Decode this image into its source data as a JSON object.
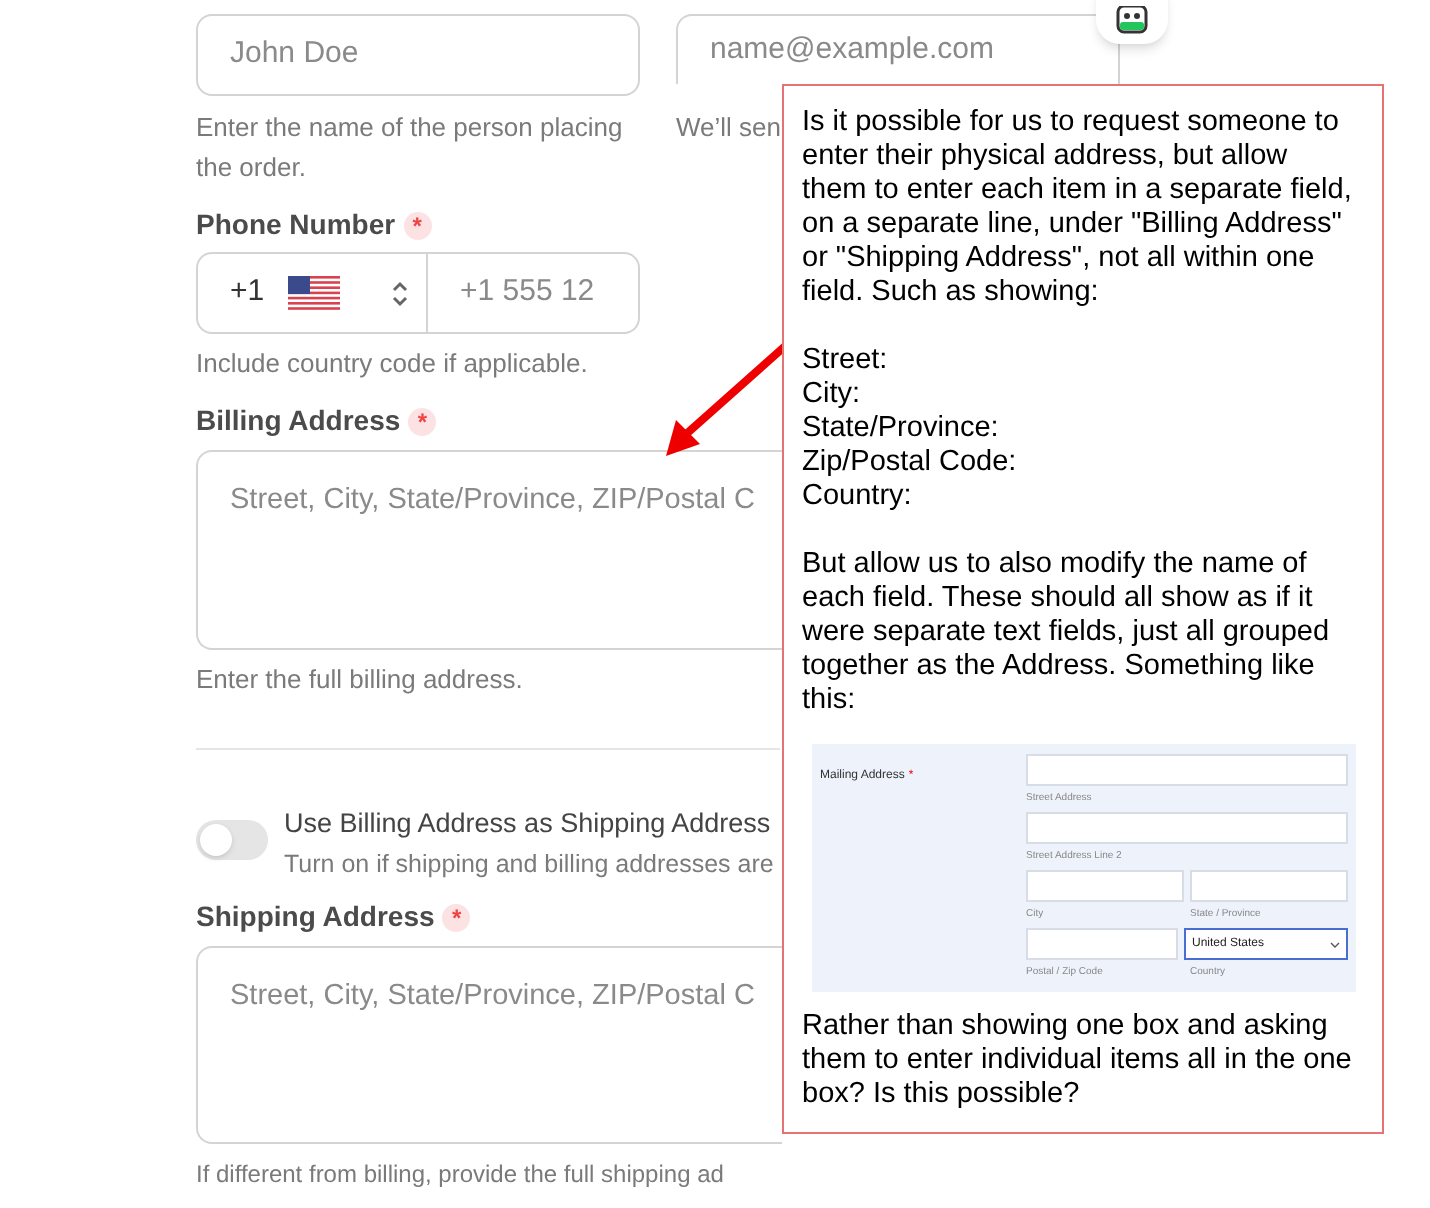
{
  "full_name": {
    "placeholder": "John Doe",
    "help": "Enter the name of the person placing the order."
  },
  "email": {
    "placeholder": "name@example.com",
    "help": "We’ll sen"
  },
  "phone": {
    "label": "Phone Number",
    "required_mark": "*",
    "code": "+1",
    "placeholder": "+1 555 12",
    "help": "Include country code if applicable."
  },
  "billing": {
    "label": "Billing Address",
    "required_mark": "*",
    "placeholder": "Street, City, State/Province, ZIP/Postal C",
    "help": "Enter the full billing address."
  },
  "same_address_toggle": {
    "label": "Use Billing Address as Shipping Address",
    "help": "Turn on if shipping and billing addresses are",
    "on": false
  },
  "shipping": {
    "label": "Shipping Address",
    "required_mark": "*",
    "placeholder": "Street, City, State/Province, ZIP/Postal C",
    "help": "If different from billing, provide the full shipping ad"
  },
  "callout": {
    "paragraphs": [
      "Is it possible for us to request someone to enter their physical address, but allow them to enter each item in a separate field, on a separate line, under \"Billing Address\" or \"Shipping Address\", not all within one field. Such as showing:",
      "Street:\nCity:\nState/Province:\nZip/Postal Code:\nCountry:",
      "But allow us to also modify the name of each field. These should all show as if it were separate text fields, just all grouped together as the Address. Something like this:"
    ],
    "example": {
      "label": "Mailing Address",
      "required_mark": "*",
      "rows": [
        {
          "inputs": [
            {
              "kind": "text"
            }
          ],
          "captions": [
            "Street Address"
          ]
        },
        {
          "inputs": [
            {
              "kind": "text"
            }
          ],
          "captions": [
            "Street Address Line 2"
          ]
        },
        {
          "inputs": [
            {
              "kind": "text"
            },
            {
              "kind": "text"
            }
          ],
          "captions": [
            "City",
            "State / Province"
          ]
        },
        {
          "inputs": [
            {
              "kind": "text"
            },
            {
              "kind": "select",
              "value": "United States"
            }
          ],
          "captions": [
            "Postal / Zip Code",
            "Country"
          ]
        }
      ]
    },
    "closing": "Rather than showing one box and asking them to enter individual items all in the one box? Is this possible?"
  }
}
